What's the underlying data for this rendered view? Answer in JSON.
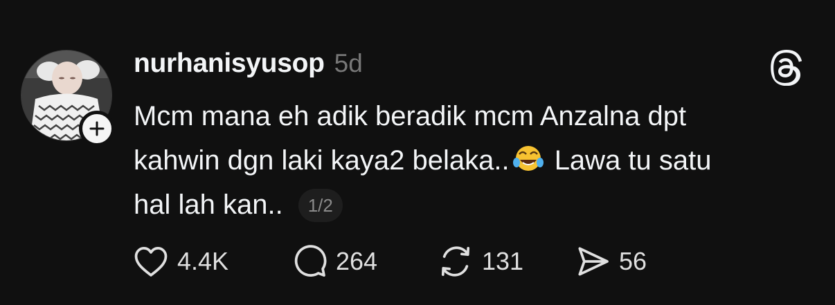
{
  "post": {
    "author": {
      "username": "nurhanisyusop",
      "avatar_icon": "baby-avatar",
      "follow_icon": "plus-icon"
    },
    "timestamp": "5d",
    "app_icon": "threads-logo-icon",
    "text": {
      "line1": "Mcm mana eh adik beradik mcm Anzalna dpt",
      "line2_start": "kahwin dgn laki kaya2 belaka..",
      "line2_emoji": "😂",
      "line2_end": "Lawa tu satu",
      "line3": "hal lah kan.."
    },
    "page_indicator": "1/2",
    "actions": {
      "likes": "4.4K",
      "replies": "264",
      "reposts": "131",
      "shares": "56"
    }
  },
  "colors": {
    "background": "#101010",
    "text_primary": "#f3f5f7",
    "text_secondary": "#777777"
  }
}
